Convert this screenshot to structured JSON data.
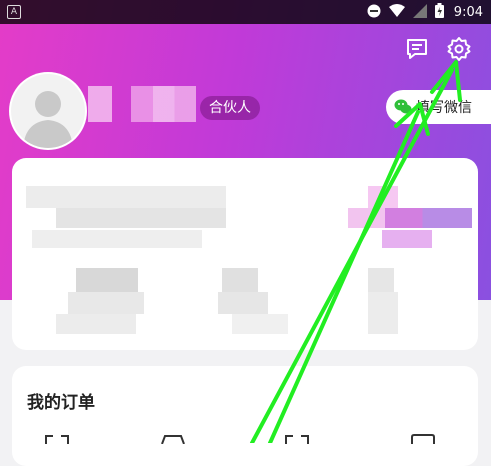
{
  "statusbar": {
    "time": "9:04",
    "app_badge": "A",
    "icons": [
      "minus-circle-icon",
      "wifi-icon",
      "signal-icon",
      "battery-icon"
    ]
  },
  "header": {
    "icons": [
      "message-icon",
      "settings-gear-icon"
    ],
    "badge": "合伙人",
    "wechat_label": "填写微信",
    "colors": {
      "gradient_start": "#e43cc8",
      "gradient_end": "#8a50e0"
    }
  },
  "orders": {
    "title": "我的订单"
  },
  "annotation": {
    "arrow_color": "#22ee22",
    "description_hidden": true
  }
}
